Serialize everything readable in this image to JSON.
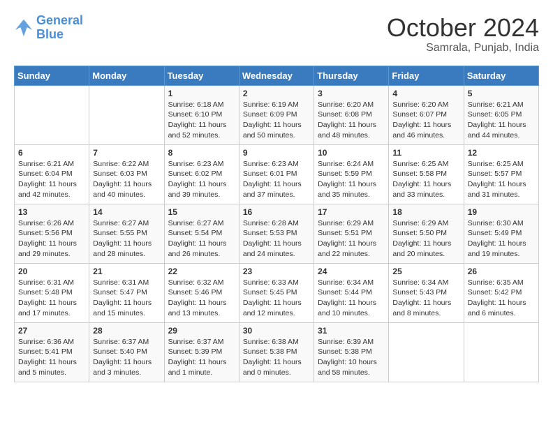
{
  "header": {
    "logo_line1": "General",
    "logo_line2": "Blue",
    "month": "October 2024",
    "location": "Samrala, Punjab, India"
  },
  "weekdays": [
    "Sunday",
    "Monday",
    "Tuesday",
    "Wednesday",
    "Thursday",
    "Friday",
    "Saturday"
  ],
  "weeks": [
    [
      {
        "day": "",
        "info": ""
      },
      {
        "day": "",
        "info": ""
      },
      {
        "day": "1",
        "info": "Sunrise: 6:18 AM\nSunset: 6:10 PM\nDaylight: 11 hours and 52 minutes."
      },
      {
        "day": "2",
        "info": "Sunrise: 6:19 AM\nSunset: 6:09 PM\nDaylight: 11 hours and 50 minutes."
      },
      {
        "day": "3",
        "info": "Sunrise: 6:20 AM\nSunset: 6:08 PM\nDaylight: 11 hours and 48 minutes."
      },
      {
        "day": "4",
        "info": "Sunrise: 6:20 AM\nSunset: 6:07 PM\nDaylight: 11 hours and 46 minutes."
      },
      {
        "day": "5",
        "info": "Sunrise: 6:21 AM\nSunset: 6:05 PM\nDaylight: 11 hours and 44 minutes."
      }
    ],
    [
      {
        "day": "6",
        "info": "Sunrise: 6:21 AM\nSunset: 6:04 PM\nDaylight: 11 hours and 42 minutes."
      },
      {
        "day": "7",
        "info": "Sunrise: 6:22 AM\nSunset: 6:03 PM\nDaylight: 11 hours and 40 minutes."
      },
      {
        "day": "8",
        "info": "Sunrise: 6:23 AM\nSunset: 6:02 PM\nDaylight: 11 hours and 39 minutes."
      },
      {
        "day": "9",
        "info": "Sunrise: 6:23 AM\nSunset: 6:01 PM\nDaylight: 11 hours and 37 minutes."
      },
      {
        "day": "10",
        "info": "Sunrise: 6:24 AM\nSunset: 5:59 PM\nDaylight: 11 hours and 35 minutes."
      },
      {
        "day": "11",
        "info": "Sunrise: 6:25 AM\nSunset: 5:58 PM\nDaylight: 11 hours and 33 minutes."
      },
      {
        "day": "12",
        "info": "Sunrise: 6:25 AM\nSunset: 5:57 PM\nDaylight: 11 hours and 31 minutes."
      }
    ],
    [
      {
        "day": "13",
        "info": "Sunrise: 6:26 AM\nSunset: 5:56 PM\nDaylight: 11 hours and 29 minutes."
      },
      {
        "day": "14",
        "info": "Sunrise: 6:27 AM\nSunset: 5:55 PM\nDaylight: 11 hours and 28 minutes."
      },
      {
        "day": "15",
        "info": "Sunrise: 6:27 AM\nSunset: 5:54 PM\nDaylight: 11 hours and 26 minutes."
      },
      {
        "day": "16",
        "info": "Sunrise: 6:28 AM\nSunset: 5:53 PM\nDaylight: 11 hours and 24 minutes."
      },
      {
        "day": "17",
        "info": "Sunrise: 6:29 AM\nSunset: 5:51 PM\nDaylight: 11 hours and 22 minutes."
      },
      {
        "day": "18",
        "info": "Sunrise: 6:29 AM\nSunset: 5:50 PM\nDaylight: 11 hours and 20 minutes."
      },
      {
        "day": "19",
        "info": "Sunrise: 6:30 AM\nSunset: 5:49 PM\nDaylight: 11 hours and 19 minutes."
      }
    ],
    [
      {
        "day": "20",
        "info": "Sunrise: 6:31 AM\nSunset: 5:48 PM\nDaylight: 11 hours and 17 minutes."
      },
      {
        "day": "21",
        "info": "Sunrise: 6:31 AM\nSunset: 5:47 PM\nDaylight: 11 hours and 15 minutes."
      },
      {
        "day": "22",
        "info": "Sunrise: 6:32 AM\nSunset: 5:46 PM\nDaylight: 11 hours and 13 minutes."
      },
      {
        "day": "23",
        "info": "Sunrise: 6:33 AM\nSunset: 5:45 PM\nDaylight: 11 hours and 12 minutes."
      },
      {
        "day": "24",
        "info": "Sunrise: 6:34 AM\nSunset: 5:44 PM\nDaylight: 11 hours and 10 minutes."
      },
      {
        "day": "25",
        "info": "Sunrise: 6:34 AM\nSunset: 5:43 PM\nDaylight: 11 hours and 8 minutes."
      },
      {
        "day": "26",
        "info": "Sunrise: 6:35 AM\nSunset: 5:42 PM\nDaylight: 11 hours and 6 minutes."
      }
    ],
    [
      {
        "day": "27",
        "info": "Sunrise: 6:36 AM\nSunset: 5:41 PM\nDaylight: 11 hours and 5 minutes."
      },
      {
        "day": "28",
        "info": "Sunrise: 6:37 AM\nSunset: 5:40 PM\nDaylight: 11 hours and 3 minutes."
      },
      {
        "day": "29",
        "info": "Sunrise: 6:37 AM\nSunset: 5:39 PM\nDaylight: 11 hours and 1 minute."
      },
      {
        "day": "30",
        "info": "Sunrise: 6:38 AM\nSunset: 5:38 PM\nDaylight: 11 hours and 0 minutes."
      },
      {
        "day": "31",
        "info": "Sunrise: 6:39 AM\nSunset: 5:38 PM\nDaylight: 10 hours and 58 minutes."
      },
      {
        "day": "",
        "info": ""
      },
      {
        "day": "",
        "info": ""
      }
    ]
  ]
}
